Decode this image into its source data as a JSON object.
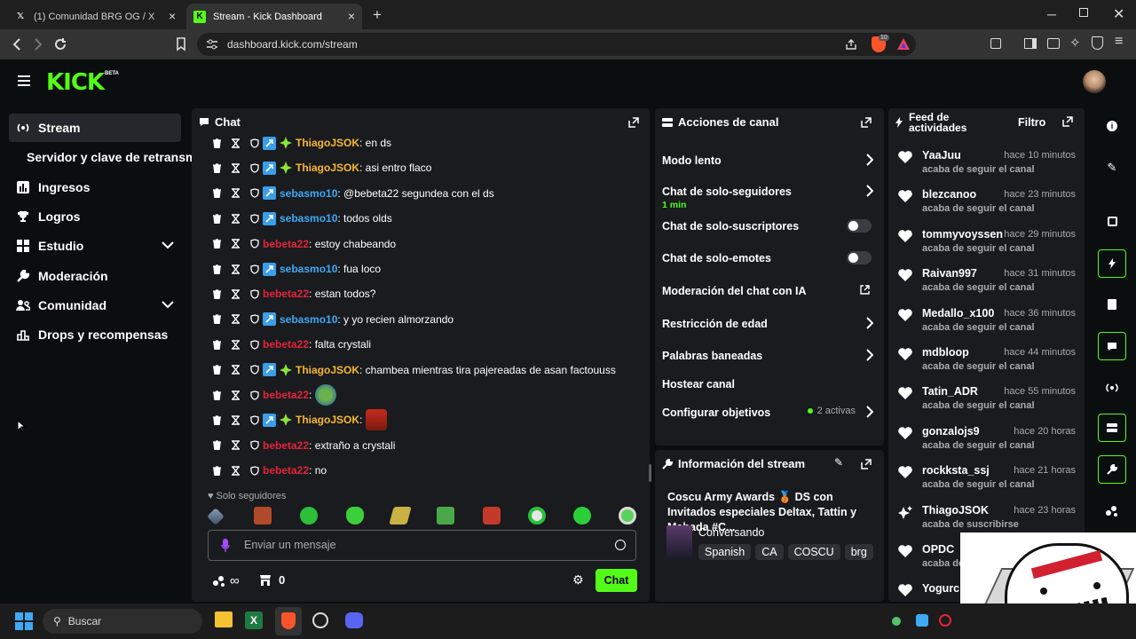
{
  "browser": {
    "tabs": [
      {
        "label": "(1) Comunidad BRG OG / X",
        "active": false
      },
      {
        "label": "Stream - Kick Dashboard",
        "active": true
      }
    ],
    "url": "dashboard.kick.com/stream",
    "shield_count": "10"
  },
  "brand": {
    "logo": "KICK",
    "beta": "BETA",
    "accent": "#53fc18"
  },
  "sidebar": {
    "items": [
      {
        "label": "Stream",
        "icon": "broadcast-icon",
        "active": true
      },
      {
        "label": "Servidor y clave de retransm",
        "icon": "",
        "sub": true
      },
      {
        "label": "Ingresos",
        "icon": "bar-chart-icon"
      },
      {
        "label": "Logros",
        "icon": "trophy-icon"
      },
      {
        "label": "Estudio",
        "icon": "grid-icon",
        "expandable": true
      },
      {
        "label": "Moderación",
        "icon": "wrench-icon"
      },
      {
        "label": "Comunidad",
        "icon": "users-icon",
        "expandable": true
      },
      {
        "label": "Drops y recompensas",
        "icon": "gift-icon"
      }
    ]
  },
  "chat": {
    "title": "Chat",
    "messages": [
      {
        "user": "ThiagoJSOK",
        "color": "#f7b733",
        "text": ": en ds",
        "badges": [
          "sub",
          "star"
        ]
      },
      {
        "user": "ThiagoJSOK",
        "color": "#f7b733",
        "text": ": asi entro flaco",
        "badges": [
          "sub",
          "star"
        ]
      },
      {
        "user": "sebasmo10",
        "color": "#3fa9f5",
        "text": ": @bebeta22 segundea con el ds",
        "badges": [
          "sub"
        ]
      },
      {
        "user": "sebasmo10",
        "color": "#3fa9f5",
        "text": ": todos olds",
        "badges": [
          "sub"
        ]
      },
      {
        "user": "bebeta22",
        "color": "#e5233a",
        "text": ": estoy chabeando",
        "badges": []
      },
      {
        "user": "sebasmo10",
        "color": "#3fa9f5",
        "text": ": fua loco",
        "badges": [
          "sub"
        ]
      },
      {
        "user": "bebeta22",
        "color": "#e5233a",
        "text": ": estan todos?",
        "badges": []
      },
      {
        "user": "sebasmo10",
        "color": "#3fa9f5",
        "text": ": y yo recien almorzando",
        "badges": [
          "sub"
        ]
      },
      {
        "user": "bebeta22",
        "color": "#e5233a",
        "text": ": falta crystali",
        "badges": []
      },
      {
        "user": "ThiagoJSOK",
        "color": "#f7b733",
        "text": ": chambea mientras tira pajereadas de asan factouuss",
        "badges": [
          "sub",
          "star"
        ]
      },
      {
        "user": "bebeta22",
        "color": "#e5233a",
        "text": ":",
        "badges": [],
        "emote": "frog-emote"
      },
      {
        "user": "ThiagoJSOK",
        "color": "#f7b733",
        "text": ":",
        "badges": [
          "sub",
          "star"
        ],
        "emote": "face-emote"
      },
      {
        "user": "bebeta22",
        "color": "#e5233a",
        "text": ": extraño a crystali",
        "badges": []
      },
      {
        "user": "bebeta22",
        "color": "#e5233a",
        "text": ": no",
        "badges": []
      }
    ],
    "followers_only": "Solo seguidores",
    "input_placeholder": "Enviar un mensaje",
    "points_value": "0",
    "send_label": "Chat"
  },
  "actions": {
    "title": "Acciones de canal",
    "rows": [
      {
        "label": "Modo lento",
        "control": "chevron"
      },
      {
        "label": "Chat de solo-seguidores",
        "sub": "1 min",
        "control": "chevron"
      },
      {
        "label": "Chat de solo-suscriptores",
        "control": "toggle"
      },
      {
        "label": "Chat de solo-emotes",
        "control": "toggle"
      },
      {
        "label": "Moderación del chat con IA",
        "control": "external"
      },
      {
        "label": "Restricción de edad",
        "control": "chevron"
      },
      {
        "label": "Palabras baneadas",
        "control": "chevron"
      },
      {
        "label": "Hostear canal",
        "control": "none"
      },
      {
        "label": "Configurar objetivos",
        "control": "chevron",
        "status": "2 activas"
      }
    ]
  },
  "stream_info": {
    "title": "Información del stream",
    "stream_title": "Coscu Army Awards 🥉 DS con Invitados especiales Deltax, Tattin y Mahada #C...",
    "category": "Conversando",
    "tags": [
      "Spanish",
      "CA",
      "COSCU",
      "brg"
    ]
  },
  "feed": {
    "title_line1": "Feed de",
    "title_line2": "actividades",
    "filter_label": "Filtro",
    "events": [
      {
        "user": "YaaJuu",
        "time": "hace 10 minutos",
        "text": "acaba de seguir el canal",
        "type": "follow"
      },
      {
        "user": "blezcanoo",
        "time": "hace 23 minutos",
        "text": "acaba de seguir el canal",
        "type": "follow"
      },
      {
        "user": "tommyvoyssen",
        "time": "hace 29 minutos",
        "text": "acaba de seguir el canal",
        "type": "follow"
      },
      {
        "user": "Raivan997",
        "time": "hace 31 minutos",
        "text": "acaba de seguir el canal",
        "type": "follow"
      },
      {
        "user": "Medallo_x100",
        "time": "hace 36 minutos",
        "text": "acaba de seguir el canal",
        "type": "follow"
      },
      {
        "user": "mdbloop",
        "time": "hace 44 minutos",
        "text": "acaba de seguir el canal",
        "type": "follow"
      },
      {
        "user": "Tatin_ADR",
        "time": "hace 55 minutos",
        "text": "acaba de seguir el canal",
        "type": "follow"
      },
      {
        "user": "gonzalojs9",
        "time": "hace 20 horas",
        "text": "acaba de seguir el canal",
        "type": "follow"
      },
      {
        "user": "rockksta_ssj",
        "time": "hace 21 horas",
        "text": "acaba de seguir el canal",
        "type": "follow"
      },
      {
        "user": "ThiagoJSOK",
        "time": "hace 23 horas",
        "text": "acaba de suscribirse",
        "type": "sub"
      },
      {
        "user": "OPDC",
        "time": "",
        "text": "acaba de",
        "type": "follow"
      },
      {
        "user": "Yogurc",
        "time": "",
        "text": "",
        "type": "follow"
      }
    ]
  },
  "taskbar": {
    "search_placeholder": "Buscar"
  }
}
